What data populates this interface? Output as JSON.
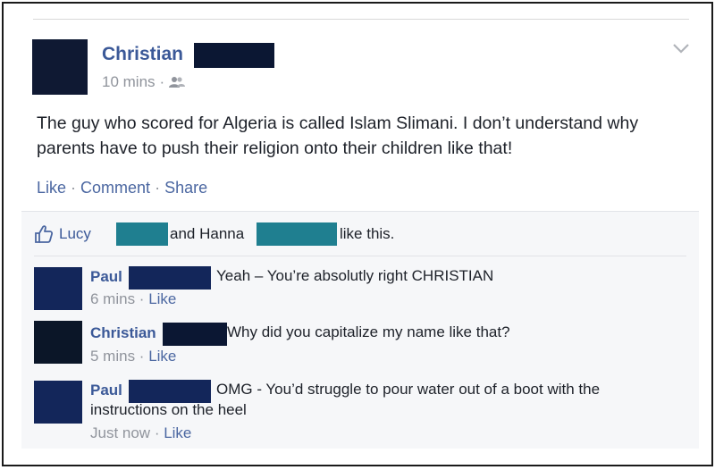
{
  "post": {
    "author_name": "Christian",
    "time": "10 mins",
    "meta_sep": "·",
    "audience_icon": "friends-icon",
    "menu_icon": "chevron-down-icon",
    "text": "The guy who scored for Algeria is called Islam Slimani. I don’t understand why parents have to push their religion onto their children like that!",
    "actions": {
      "like": "Like",
      "comment": "Comment",
      "share": "Share",
      "sep": "·"
    }
  },
  "likes": {
    "icon": "thumbs-up-icon",
    "user1": "Lucy",
    "and": "and Hanna",
    "suffix": "like this."
  },
  "comments": [
    {
      "name": "Paul",
      "text": "Yeah – You’re absolutly right CHRISTIAN",
      "time": "6 mins",
      "like": "Like"
    },
    {
      "name": "Christian",
      "text": "Why did you capitalize my name like that?",
      "time": "5 mins",
      "like": "Like"
    },
    {
      "name": "Paul",
      "text": "OMG - You’d struggle to pour water out of a boot with the",
      "text2": "instructions on the heel",
      "time": "Just now",
      "like": "Like"
    }
  ],
  "colors": {
    "link_blue": "#3b5998",
    "muted": "#90949c",
    "redaction_dark": "#0b1733",
    "redaction_teal": "#1f7f90"
  }
}
